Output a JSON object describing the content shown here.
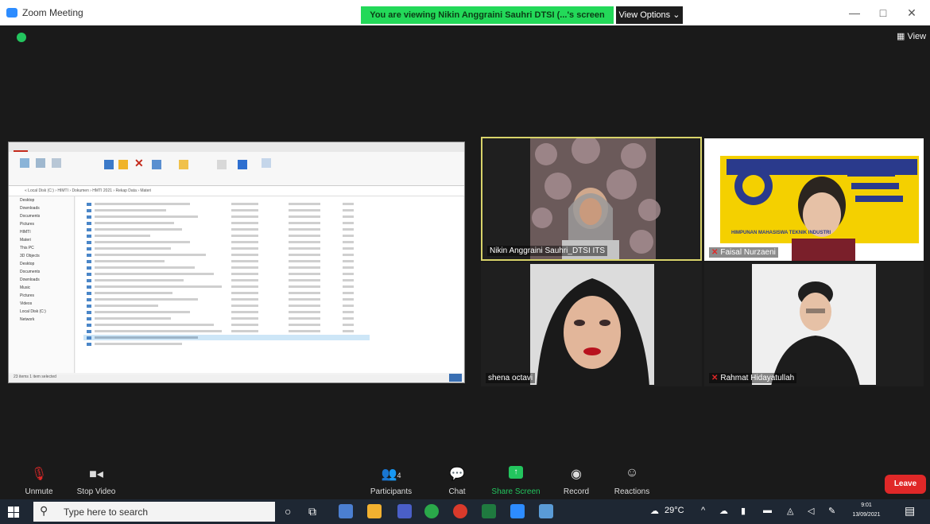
{
  "window": {
    "title": "Zoom Meeting",
    "banner": "You are viewing Nikin Anggraini Sauhri DTSI (...'s screen",
    "view_options": "View Options ⌄",
    "view_button": "View",
    "minimize": "—",
    "maximize": "□",
    "close": "✕"
  },
  "share": {
    "address": "« Local Disk (C:) › HIMTI › Dokumen › HMTI 2021 › Rekap Data › Materi",
    "nav_items": [
      "Desktop",
      "Downloads",
      "Documents",
      "Pictures",
      "HIMTI",
      "Materi",
      "This PC",
      "3D Objects",
      "Desktop",
      "Documents",
      "Downloads",
      "Music",
      "Pictures",
      "Videos",
      "Local Disk (C:)",
      "Network"
    ],
    "status": "23 items   1 item selected"
  },
  "participants": [
    {
      "name": "Nikin Anggraini Sauhri_DTSI ITS",
      "muted": false,
      "active": true
    },
    {
      "name": "Faisal Nurzaeni",
      "muted": true,
      "active": false
    },
    {
      "name": "shena octavi",
      "muted": false,
      "active": false
    },
    {
      "name": "Rahmat Hidayatullah",
      "muted": true,
      "active": false
    }
  ],
  "banner_org": "HIMPUNAN MAHASISWA TEKNIK INDUSTRI",
  "toolbar": {
    "unmute": "Unmute",
    "stop_video": "Stop Video",
    "participants": "Participants",
    "participants_count": "4",
    "chat": "Chat",
    "share_screen": "Share Screen",
    "record": "Record",
    "reactions": "Reactions",
    "leave": "Leave"
  },
  "taskbar": {
    "search_placeholder": "Type here to search",
    "weather": "29°C",
    "time": "9:01",
    "date": "13/09/2021"
  },
  "colors": {
    "banner_green": "#23d959",
    "leave_red": "#e02828",
    "active_border": "#d8d36a"
  }
}
